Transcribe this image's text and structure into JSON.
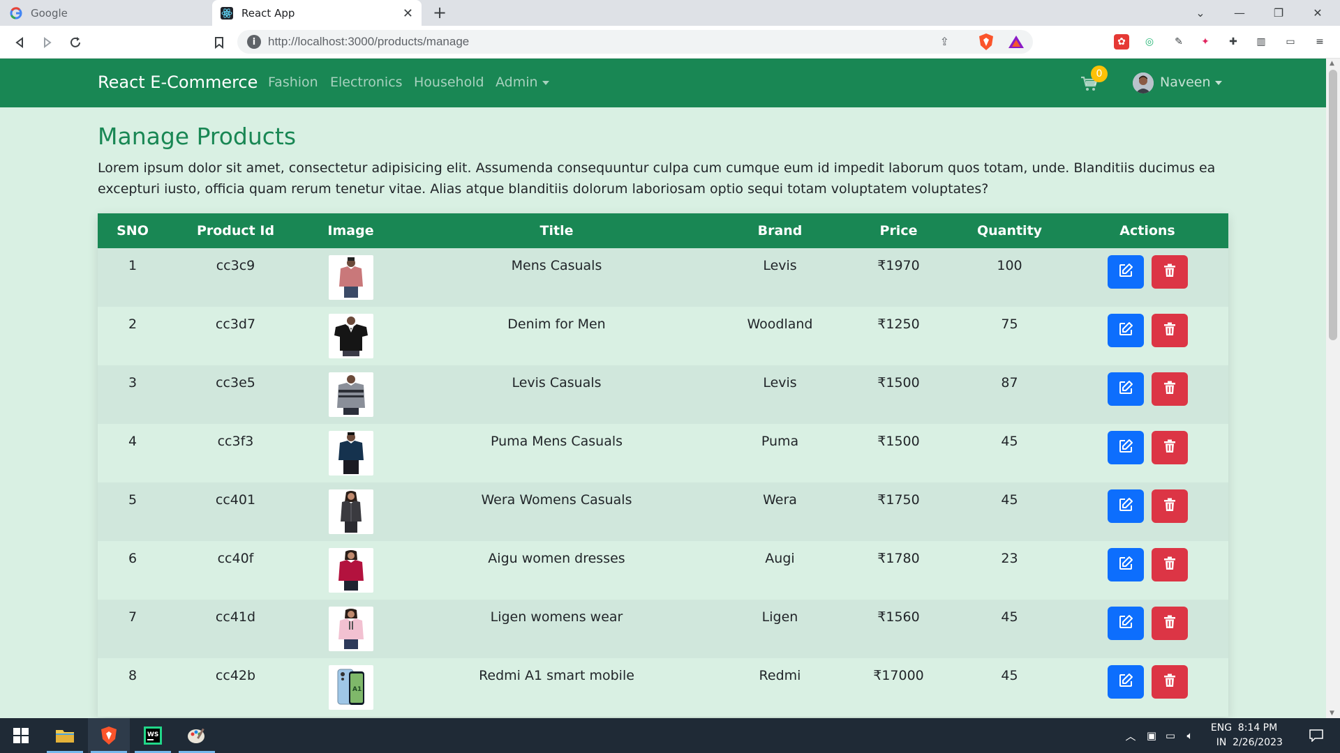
{
  "browser": {
    "tabs": [
      {
        "title": "Google",
        "active": false,
        "icon": "google-icon"
      },
      {
        "title": "React App",
        "active": true,
        "icon": "react-icon"
      }
    ],
    "url": "http://localhost:3000/products/manage"
  },
  "navbar": {
    "brand": "React E-Commerce",
    "links": [
      "Fashion",
      "Electronics",
      "Household"
    ],
    "admin_label": "Admin",
    "cart_count": "0",
    "user_name": "Naveen"
  },
  "page": {
    "title": "Manage Products",
    "intro": "Lorem ipsum dolor sit amet, consectetur adipisicing elit. Assumenda consequuntur culpa cum cumque eum id impedit laborum quos totam, unde. Blanditiis ducimus ea excepturi iusto, officia quam rerum tenetur vitae. Alias atque blanditiis dolorum laboriosam optio sequi totam voluptatem voluptates?"
  },
  "table": {
    "headers": [
      "SNO",
      "Product Id",
      "Image",
      "Title",
      "Brand",
      "Price",
      "Quantity",
      "Actions"
    ],
    "rows": [
      {
        "sno": "1",
        "id": "cc3c9",
        "title": "Mens Casuals",
        "brand": "Levis",
        "price": "₹1970",
        "qty": "100",
        "image": "mens-casual-shirt-image"
      },
      {
        "sno": "2",
        "id": "cc3d7",
        "title": "Denim for Men",
        "brand": "Woodland",
        "price": "₹1250",
        "qty": "75",
        "image": "black-polo-image"
      },
      {
        "sno": "3",
        "id": "cc3e5",
        "title": "Levis Casuals",
        "brand": "Levis",
        "price": "₹1500",
        "qty": "87",
        "image": "grey-shirt-image"
      },
      {
        "sno": "4",
        "id": "cc3f3",
        "title": "Puma Mens Casuals",
        "brand": "Puma",
        "price": "₹1500",
        "qty": "45",
        "image": "navy-shirt-image"
      },
      {
        "sno": "5",
        "id": "cc401",
        "title": "Wera Womens Casuals",
        "brand": "Wera",
        "price": "₹1750",
        "qty": "45",
        "image": "womens-casual-image"
      },
      {
        "sno": "6",
        "id": "cc40f",
        "title": "Aigu women dresses",
        "brand": "Augi",
        "price": "₹1780",
        "qty": "23",
        "image": "red-sweater-image"
      },
      {
        "sno": "7",
        "id": "cc41d",
        "title": "Ligen womens wear",
        "brand": "Ligen",
        "price": "₹1560",
        "qty": "45",
        "image": "pink-hoodie-image"
      },
      {
        "sno": "8",
        "id": "cc42b",
        "title": "Redmi A1 smart mobile",
        "brand": "Redmi",
        "price": "₹17000",
        "qty": "45",
        "image": "smartphone-image"
      }
    ]
  },
  "taskbar": {
    "lang_line1": "ENG",
    "lang_line2": "IN",
    "time": "8:14 PM",
    "date": "2/26/2023"
  },
  "colors": {
    "primary_green": "#198754",
    "page_bg": "#d9f0e3",
    "edit_blue": "#0d6efd",
    "delete_red": "#dc3545",
    "badge_yellow": "#ffc107"
  }
}
